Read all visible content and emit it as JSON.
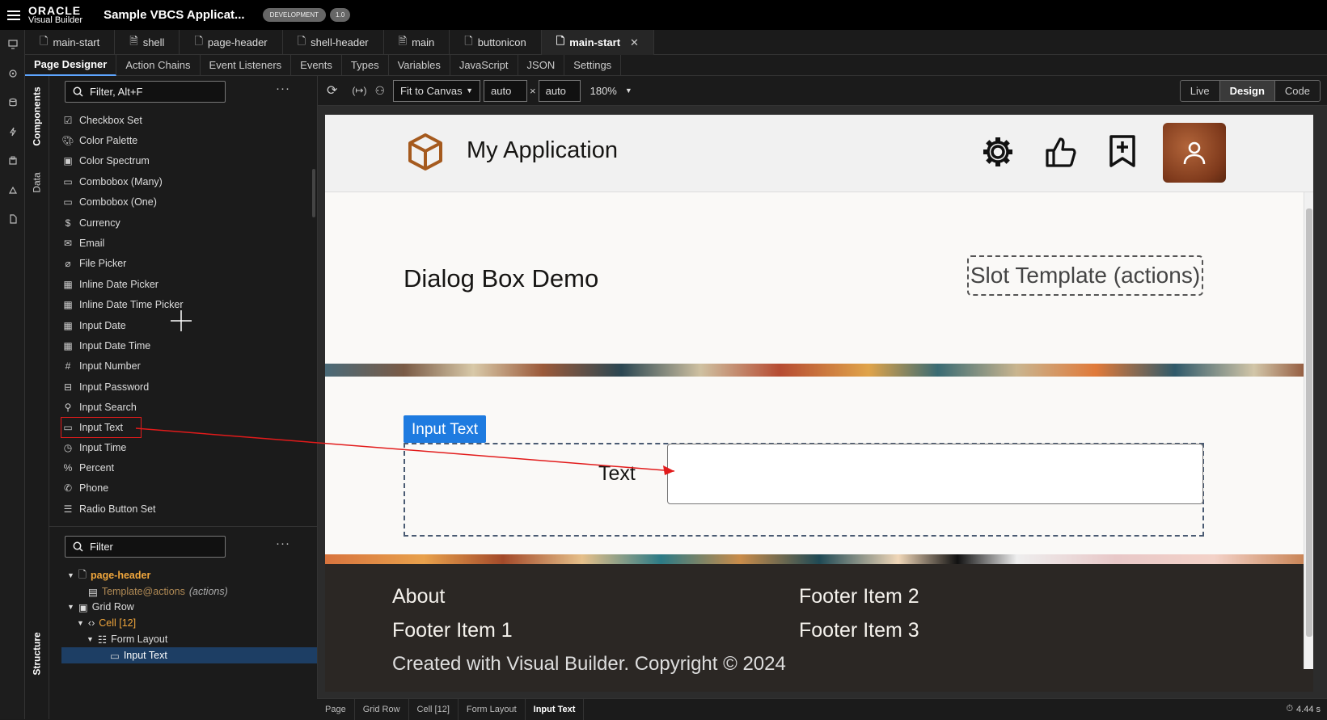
{
  "app": {
    "brand_top": "ORACLE",
    "brand_bottom": "Visual Builder",
    "title": "Sample VBCS Applicat...",
    "env_badge": "DEVELOPMENT",
    "version_badge": "1.0"
  },
  "file_tabs": [
    {
      "label": "main-start"
    },
    {
      "label": "shell"
    },
    {
      "label": "page-header"
    },
    {
      "label": "shell-header"
    },
    {
      "label": "main"
    },
    {
      "label": "buttonicon"
    },
    {
      "label": "main-start",
      "active": true
    }
  ],
  "sub_tabs": [
    "Page Designer",
    "Action Chains",
    "Event Listeners",
    "Events",
    "Types",
    "Variables",
    "JavaScript",
    "JSON",
    "Settings"
  ],
  "side_tabs": {
    "components": "Components",
    "data": "Data",
    "structure": "Structure"
  },
  "components": {
    "filter_placeholder": "Filter, Alt+F",
    "items": [
      {
        "label": "Checkbox Set",
        "icon": "checkbox-set-icon"
      },
      {
        "label": "Color Palette",
        "icon": "palette-icon"
      },
      {
        "label": "Color Spectrum",
        "icon": "spectrum-icon"
      },
      {
        "label": "Combobox (Many)",
        "icon": "combobox-icon"
      },
      {
        "label": "Combobox (One)",
        "icon": "combobox-icon"
      },
      {
        "label": "Currency",
        "icon": "dollar-icon"
      },
      {
        "label": "Email",
        "icon": "mail-icon"
      },
      {
        "label": "File Picker",
        "icon": "paperclip-icon"
      },
      {
        "label": "Inline Date Picker",
        "icon": "calendar-icon"
      },
      {
        "label": "Inline Date Time Picker",
        "icon": "calendar-icon"
      },
      {
        "label": "Input Date",
        "icon": "calendar-icon"
      },
      {
        "label": "Input Date Time",
        "icon": "calendar-icon"
      },
      {
        "label": "Input Number",
        "icon": "hash-icon"
      },
      {
        "label": "Input Password",
        "icon": "password-icon"
      },
      {
        "label": "Input Search",
        "icon": "search-icon"
      },
      {
        "label": "Input Text",
        "icon": "input-text-icon"
      },
      {
        "label": "Input Time",
        "icon": "clock-icon"
      },
      {
        "label": "Percent",
        "icon": "percent-icon"
      },
      {
        "label": "Phone",
        "icon": "phone-icon"
      },
      {
        "label": "Radio Button Set",
        "icon": "radio-list-icon"
      }
    ]
  },
  "structure": {
    "filter_placeholder": "Filter",
    "nodes": {
      "page_header": "page-header",
      "template": "Template",
      "template_slot": "@actions",
      "template_note": "(actions)",
      "grid_row": "Grid Row",
      "cell": "Cell [12]",
      "form_layout": "Form Layout",
      "input_text": "Input Text"
    }
  },
  "toolbar": {
    "fit": "Fit to Canvas",
    "width": "auto",
    "times": "×",
    "height": "auto",
    "zoom": "180%",
    "modes": {
      "live": "Live",
      "design": "Design",
      "code": "Code"
    }
  },
  "canvas": {
    "app_title": "My Application",
    "dialog_title": "Dialog Box Demo",
    "slot_template": "Slot Template (actions)",
    "input_label_chip": "Input Text",
    "field_label": "Text",
    "footer": {
      "about": "About",
      "item1": "Footer Item 1",
      "item2": "Footer Item 2",
      "item3": "Footer Item 3",
      "copyright": "Created with Visual Builder. Copyright © 2024"
    }
  },
  "breadcrumb": [
    "Page",
    "Grid Row",
    "Cell [12]",
    "Form Layout",
    "Input Text"
  ],
  "status": {
    "timer": "4.44 s"
  },
  "colors": {
    "accent": "#1e7be0",
    "selection": "#e21b1b",
    "tree_highlight": "#1d3e64"
  }
}
